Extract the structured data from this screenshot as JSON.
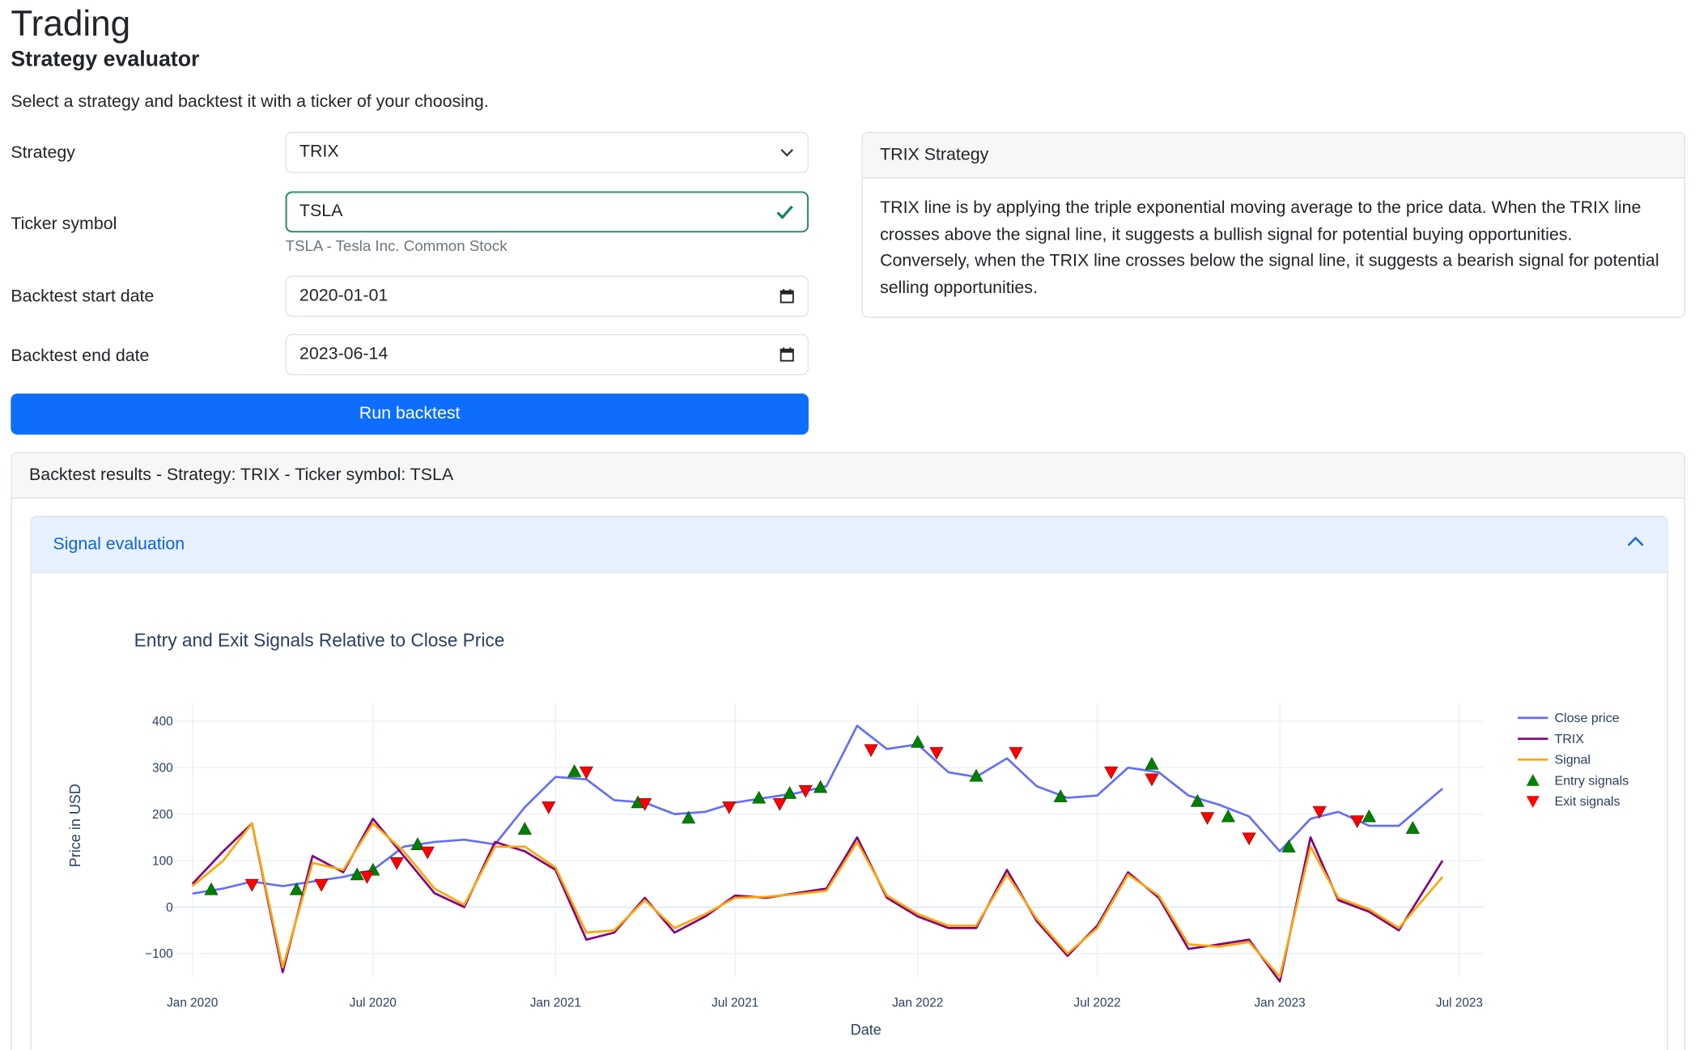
{
  "header": {
    "title": "Trading",
    "subtitle": "Strategy evaluator",
    "intro": "Select a strategy and backtest it with a ticker of your choosing."
  },
  "form": {
    "strategy_label": "Strategy",
    "strategy_value": "TRIX",
    "ticker_label": "Ticker symbol",
    "ticker_value": "TSLA",
    "ticker_help": "TSLA - Tesla Inc. Common Stock",
    "start_label": "Backtest start date",
    "start_value": "2020-01-01",
    "end_label": "Backtest end date",
    "end_value": "2023-06-14",
    "run_label": "Run backtest"
  },
  "info_card": {
    "title": "TRIX Strategy",
    "body": "TRIX line is by applying the triple exponential moving average to the price data. When the TRIX line crosses above the signal line, it suggests a bullish signal for potential buying opportunities. Conversely, when the TRIX line crosses below the signal line, it suggests a bearish signal for potential selling opportunities."
  },
  "results_card": {
    "title": "Backtest results - Strategy: TRIX - Ticker symbol: TSLA",
    "accordion_title": "Signal evaluation"
  },
  "colors": {
    "close": "#636efa",
    "trix": "#800080",
    "signal": "#ffa500",
    "entry": "#008000",
    "exit": "#ff0000",
    "primary": "#0d6efd"
  },
  "chart_data": {
    "type": "line",
    "title": "Entry and Exit Signals Relative to Close Price",
    "xlabel": "Date",
    "ylabel": "Price in USD",
    "ylim": [
      -160,
      420
    ],
    "yticks": [
      400,
      300,
      200,
      100,
      0,
      -100
    ],
    "ytick_labels": [
      "400",
      "300",
      "200",
      "100",
      "0",
      "−100"
    ],
    "xticks": [
      "Jan 2020",
      "Jul 2020",
      "Jan 2021",
      "Jul 2021",
      "Jan 2022",
      "Jul 2022",
      "Jan 2023",
      "Jul 2023"
    ],
    "xlim": [
      "2020-01-01",
      "2023-07-01"
    ],
    "legend_position": "right",
    "series": [
      {
        "name": "Close price",
        "x": [
          "2020-01-01",
          "2020-02-01",
          "2020-03-01",
          "2020-04-01",
          "2020-05-01",
          "2020-06-01",
          "2020-07-01",
          "2020-08-01",
          "2020-09-01",
          "2020-10-01",
          "2020-11-01",
          "2020-12-01",
          "2021-01-01",
          "2021-02-01",
          "2021-03-01",
          "2021-04-01",
          "2021-05-01",
          "2021-06-01",
          "2021-07-01",
          "2021-08-01",
          "2021-09-01",
          "2021-10-01",
          "2021-11-01",
          "2021-12-01",
          "2022-01-01",
          "2022-02-01",
          "2022-03-01",
          "2022-04-01",
          "2022-05-01",
          "2022-06-01",
          "2022-07-01",
          "2022-08-01",
          "2022-09-01",
          "2022-10-01",
          "2022-11-01",
          "2022-12-01",
          "2023-01-01",
          "2023-02-01",
          "2023-03-01",
          "2023-04-01",
          "2023-05-01",
          "2023-06-14"
        ],
        "values": [
          29,
          40,
          55,
          45,
          55,
          65,
          80,
          130,
          140,
          145,
          135,
          215,
          280,
          275,
          230,
          225,
          200,
          205,
          225,
          235,
          245,
          260,
          390,
          340,
          350,
          290,
          280,
          320,
          260,
          235,
          240,
          300,
          290,
          240,
          220,
          195,
          120,
          190,
          205,
          175,
          175,
          255
        ]
      },
      {
        "name": "TRIX",
        "x": [
          "2020-01-01",
          "2020-02-01",
          "2020-03-01",
          "2020-04-01",
          "2020-05-01",
          "2020-06-01",
          "2020-07-01",
          "2020-08-01",
          "2020-09-01",
          "2020-10-01",
          "2020-11-01",
          "2020-12-01",
          "2021-01-01",
          "2021-02-01",
          "2021-03-01",
          "2021-04-01",
          "2021-05-01",
          "2021-06-01",
          "2021-07-01",
          "2021-08-01",
          "2021-09-01",
          "2021-10-01",
          "2021-11-01",
          "2021-12-01",
          "2022-01-01",
          "2022-02-01",
          "2022-03-01",
          "2022-04-01",
          "2022-05-01",
          "2022-06-01",
          "2022-07-01",
          "2022-08-01",
          "2022-09-01",
          "2022-10-01",
          "2022-11-01",
          "2022-12-01",
          "2023-01-01",
          "2023-02-01",
          "2023-03-01",
          "2023-04-01",
          "2023-05-01",
          "2023-06-14"
        ],
        "values": [
          50,
          120,
          180,
          -140,
          110,
          75,
          190,
          110,
          30,
          0,
          140,
          120,
          80,
          -70,
          -55,
          20,
          -55,
          -20,
          25,
          20,
          30,
          40,
          150,
          20,
          -20,
          -45,
          -45,
          80,
          -30,
          -105,
          -40,
          75,
          20,
          -90,
          -80,
          -70,
          -160,
          150,
          15,
          -10,
          -50,
          100
        ]
      },
      {
        "name": "Signal",
        "x": [
          "2020-01-01",
          "2020-02-01",
          "2020-03-01",
          "2020-04-01",
          "2020-05-01",
          "2020-06-01",
          "2020-07-01",
          "2020-08-01",
          "2020-09-01",
          "2020-10-01",
          "2020-11-01",
          "2020-12-01",
          "2021-01-01",
          "2021-02-01",
          "2021-03-01",
          "2021-04-01",
          "2021-05-01",
          "2021-06-01",
          "2021-07-01",
          "2021-08-01",
          "2021-09-01",
          "2021-10-01",
          "2021-11-01",
          "2021-12-01",
          "2022-01-01",
          "2022-02-01",
          "2022-03-01",
          "2022-04-01",
          "2022-05-01",
          "2022-06-01",
          "2022-07-01",
          "2022-08-01",
          "2022-09-01",
          "2022-10-01",
          "2022-11-01",
          "2022-12-01",
          "2023-01-01",
          "2023-02-01",
          "2023-03-01",
          "2023-04-01",
          "2023-05-01",
          "2023-06-14"
        ],
        "values": [
          45,
          100,
          180,
          -130,
          95,
          80,
          180,
          120,
          40,
          5,
          130,
          130,
          85,
          -55,
          -50,
          15,
          -45,
          -15,
          20,
          22,
          28,
          35,
          140,
          25,
          -15,
          -40,
          -40,
          70,
          -25,
          -100,
          -45,
          70,
          25,
          -80,
          -85,
          -75,
          -150,
          130,
          20,
          -5,
          -45,
          65
        ]
      }
    ],
    "markers": {
      "entry": [
        {
          "x": "2020-01-20",
          "y": 38
        },
        {
          "x": "2020-04-15",
          "y": 38
        },
        {
          "x": "2020-06-15",
          "y": 70
        },
        {
          "x": "2020-07-01",
          "y": 80
        },
        {
          "x": "2020-08-15",
          "y": 135
        },
        {
          "x": "2020-12-01",
          "y": 168
        },
        {
          "x": "2021-01-20",
          "y": 292
        },
        {
          "x": "2021-03-25",
          "y": 225
        },
        {
          "x": "2021-05-15",
          "y": 192
        },
        {
          "x": "2021-07-25",
          "y": 235
        },
        {
          "x": "2021-08-25",
          "y": 245
        },
        {
          "x": "2021-09-25",
          "y": 258
        },
        {
          "x": "2022-01-01",
          "y": 355
        },
        {
          "x": "2022-03-01",
          "y": 282
        },
        {
          "x": "2022-05-25",
          "y": 238
        },
        {
          "x": "2022-08-25",
          "y": 308
        },
        {
          "x": "2022-10-10",
          "y": 228
        },
        {
          "x": "2022-11-10",
          "y": 195
        },
        {
          "x": "2023-01-10",
          "y": 130
        },
        {
          "x": "2023-04-01",
          "y": 195
        },
        {
          "x": "2023-05-15",
          "y": 170
        }
      ],
      "exit": [
        {
          "x": "2020-03-01",
          "y": 48
        },
        {
          "x": "2020-05-10",
          "y": 48
        },
        {
          "x": "2020-06-25",
          "y": 65
        },
        {
          "x": "2020-07-25",
          "y": 95
        },
        {
          "x": "2020-08-25",
          "y": 118
        },
        {
          "x": "2020-12-25",
          "y": 215
        },
        {
          "x": "2021-02-01",
          "y": 290
        },
        {
          "x": "2021-04-01",
          "y": 222
        },
        {
          "x": "2021-06-25",
          "y": 215
        },
        {
          "x": "2021-08-15",
          "y": 222
        },
        {
          "x": "2021-09-10",
          "y": 250
        },
        {
          "x": "2021-11-15",
          "y": 338
        },
        {
          "x": "2022-01-20",
          "y": 332
        },
        {
          "x": "2022-04-10",
          "y": 332
        },
        {
          "x": "2022-07-15",
          "y": 290
        },
        {
          "x": "2022-08-25",
          "y": 275
        },
        {
          "x": "2022-10-20",
          "y": 192
        },
        {
          "x": "2022-12-01",
          "y": 148
        },
        {
          "x": "2023-02-10",
          "y": 205
        },
        {
          "x": "2023-03-20",
          "y": 185
        }
      ]
    }
  }
}
